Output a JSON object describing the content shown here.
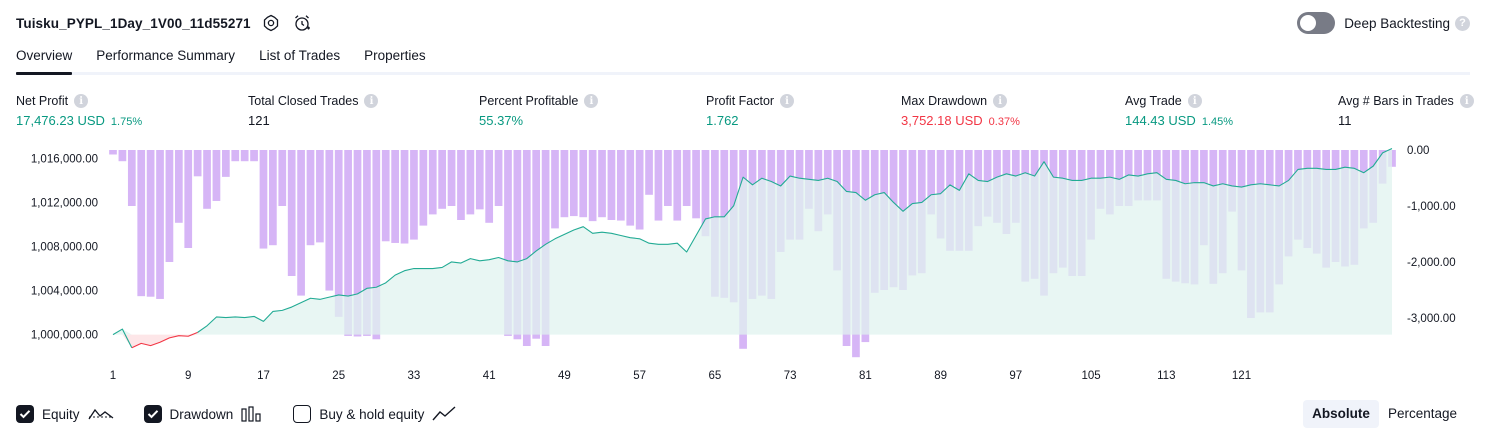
{
  "header": {
    "title": "Tuisku_PYPL_1Day_1V00_11d55271",
    "settings_icon": "gear-icon",
    "alert_icon": "alarm-clock-plus-icon",
    "deep_backtesting_label": "Deep Backtesting",
    "deep_backtesting_enabled": false,
    "help_glyph": "?"
  },
  "tabs": [
    {
      "label": "Overview",
      "active": true
    },
    {
      "label": "Performance Summary",
      "active": false
    },
    {
      "label": "List of Trades",
      "active": false
    },
    {
      "label": "Properties",
      "active": false
    }
  ],
  "metrics": {
    "net_profit": {
      "label": "Net Profit",
      "value": "17,476.23 USD",
      "pct": "1.75%"
    },
    "total_closed_trades": {
      "label": "Total Closed Trades",
      "value": "121"
    },
    "percent_profitable": {
      "label": "Percent Profitable",
      "value": "55.37%"
    },
    "profit_factor": {
      "label": "Profit Factor",
      "value": "1.762"
    },
    "max_drawdown": {
      "label": "Max Drawdown",
      "value": "3,752.18 USD",
      "pct": "0.37%"
    },
    "avg_trade": {
      "label": "Avg Trade",
      "value": "144.43 USD",
      "pct": "1.45%"
    },
    "avg_bars": {
      "label": "Avg # Bars in Trades",
      "value": "11"
    },
    "info_glyph": "i"
  },
  "colors": {
    "positive": "#089981",
    "negative": "#f23645",
    "drawdown_bar": "#cfa8f5",
    "equity_line": "#22ab94",
    "equity_fill": "#e0f3ef",
    "equity_below_line": "#f23645"
  },
  "chart_data": {
    "type": "area",
    "x_ticks": [
      "1",
      "9",
      "17",
      "25",
      "33",
      "41",
      "49",
      "57",
      "65",
      "73",
      "81",
      "89",
      "97",
      "105",
      "113",
      "121"
    ],
    "left_axis": {
      "ticks": [
        "1,016,000.00",
        "1,012,000.00",
        "1,008,000.00",
        "1,004,000.00",
        "1,000,000.00"
      ],
      "ylim": [
        998600,
        1017400
      ]
    },
    "right_axis": {
      "ticks": [
        "0.00",
        "-1,000.00",
        "-2,000.00",
        "-3,000.00"
      ],
      "ylim": [
        -3750,
        0
      ]
    },
    "series": [
      {
        "name": "Equity",
        "x_start": 1,
        "values": [
          1000000,
          1000500,
          998800,
          999200,
          999000,
          999300,
          999700,
          999900,
          999850,
          1000200,
          1000800,
          1001600,
          1001550,
          1001600,
          1001550,
          1001650,
          1001200,
          1002100,
          1002200,
          1002500,
          1002900,
          1003300,
          1003200,
          1003400,
          1003600,
          1003500,
          1003700,
          1004200,
          1004300,
          1004700,
          1005400,
          1005800,
          1006000,
          1006000,
          1006000,
          1006100,
          1006600,
          1006500,
          1006900,
          1006700,
          1006800,
          1007000,
          1006700,
          1006600,
          1006900,
          1007600,
          1008200,
          1008700,
          1009100,
          1009500,
          1009800,
          1009200,
          1009300,
          1009200,
          1009000,
          1008800,
          1008700,
          1008300,
          1008200,
          1008200,
          1008300,
          1007500,
          1009000,
          1010500,
          1010700,
          1010700,
          1011700,
          1014300,
          1013600,
          1014200,
          1013900,
          1013500,
          1014400,
          1014200,
          1014100,
          1014000,
          1014200,
          1013900,
          1013000,
          1012900,
          1012200,
          1012700,
          1012900,
          1012000,
          1011200,
          1011900,
          1012000,
          1012700,
          1012800,
          1013600,
          1013100,
          1014600,
          1014000,
          1013900,
          1014300,
          1014600,
          1014400,
          1014700,
          1014400,
          1015700,
          1014300,
          1014200,
          1014000,
          1014000,
          1014200,
          1014200,
          1014300,
          1014100,
          1014500,
          1014400,
          1014600,
          1014700,
          1014100,
          1014000,
          1013700,
          1013800,
          1013800,
          1013500,
          1013700,
          1013500,
          1013400,
          1013600,
          1013700,
          1013600,
          1013500,
          1014000,
          1015000,
          1015100,
          1015100,
          1015000,
          1015000,
          1015200,
          1015100,
          1014700,
          1015300,
          1016500,
          1016900
        ]
      },
      {
        "name": "Drawdown",
        "x_start": 1,
        "values": [
          -80,
          -200,
          -1000,
          -2610,
          -2620,
          -2660,
          -2000,
          -1300,
          -1750,
          -470,
          -1050,
          -910,
          -480,
          -200,
          -200,
          -200,
          -1760,
          -1700,
          -1000,
          -2250,
          -2600,
          -1700,
          -1650,
          -2510,
          -2980,
          -3320,
          -3330,
          -3320,
          -3380,
          -1630,
          -1660,
          -1670,
          -1600,
          -1350,
          -1150,
          -1050,
          -1000,
          -1250,
          -1150,
          -1060,
          -1300,
          -1000,
          -3320,
          -3380,
          -3500,
          -3370,
          -3500,
          -1400,
          -1200,
          -1180,
          -1200,
          -1270,
          -1200,
          -1250,
          -1260,
          -1350,
          -1420,
          -800,
          -1260,
          -1000,
          -1260,
          -1000,
          -1220,
          -1540,
          -2620,
          -2640,
          -2720,
          -3550,
          -2660,
          -2600,
          -2660,
          -1820,
          -1600,
          -1600,
          -1050,
          -1450,
          -1150,
          -2150,
          -3500,
          -3700,
          -3430,
          -2550,
          -2500,
          -2450,
          -2500,
          -2240,
          -2200,
          -1150,
          -1580,
          -1800,
          -1800,
          -1800,
          -1360,
          -1190,
          -1300,
          -1500,
          -1300,
          -2350,
          -2300,
          -2600,
          -2200,
          -2100,
          -2250,
          -2250,
          -1600,
          -1050,
          -1150,
          -1000,
          -1000,
          -900,
          -900,
          -900,
          -2300,
          -2350,
          -2380,
          -2400,
          -1700,
          -2390,
          -2200,
          -1100,
          -2150,
          -3000,
          -2900,
          -2900,
          -2400,
          -1900,
          -1600,
          -1750,
          -1850,
          -2100,
          -2000,
          -2080,
          -2050,
          -1400,
          -1300,
          -600,
          -300
        ]
      }
    ],
    "grid": false,
    "legend": "bottom-left"
  },
  "footer": {
    "equity": {
      "label": "Equity",
      "checked": true,
      "icon": "equity-line-icon"
    },
    "drawdown": {
      "label": "Drawdown",
      "checked": true,
      "icon": "drawdown-bars-icon"
    },
    "buy_hold": {
      "label": "Buy & hold equity",
      "checked": false,
      "icon": "buy-hold-line-icon"
    },
    "modes": [
      {
        "label": "Absolute",
        "active": true
      },
      {
        "label": "Percentage",
        "active": false
      }
    ]
  }
}
